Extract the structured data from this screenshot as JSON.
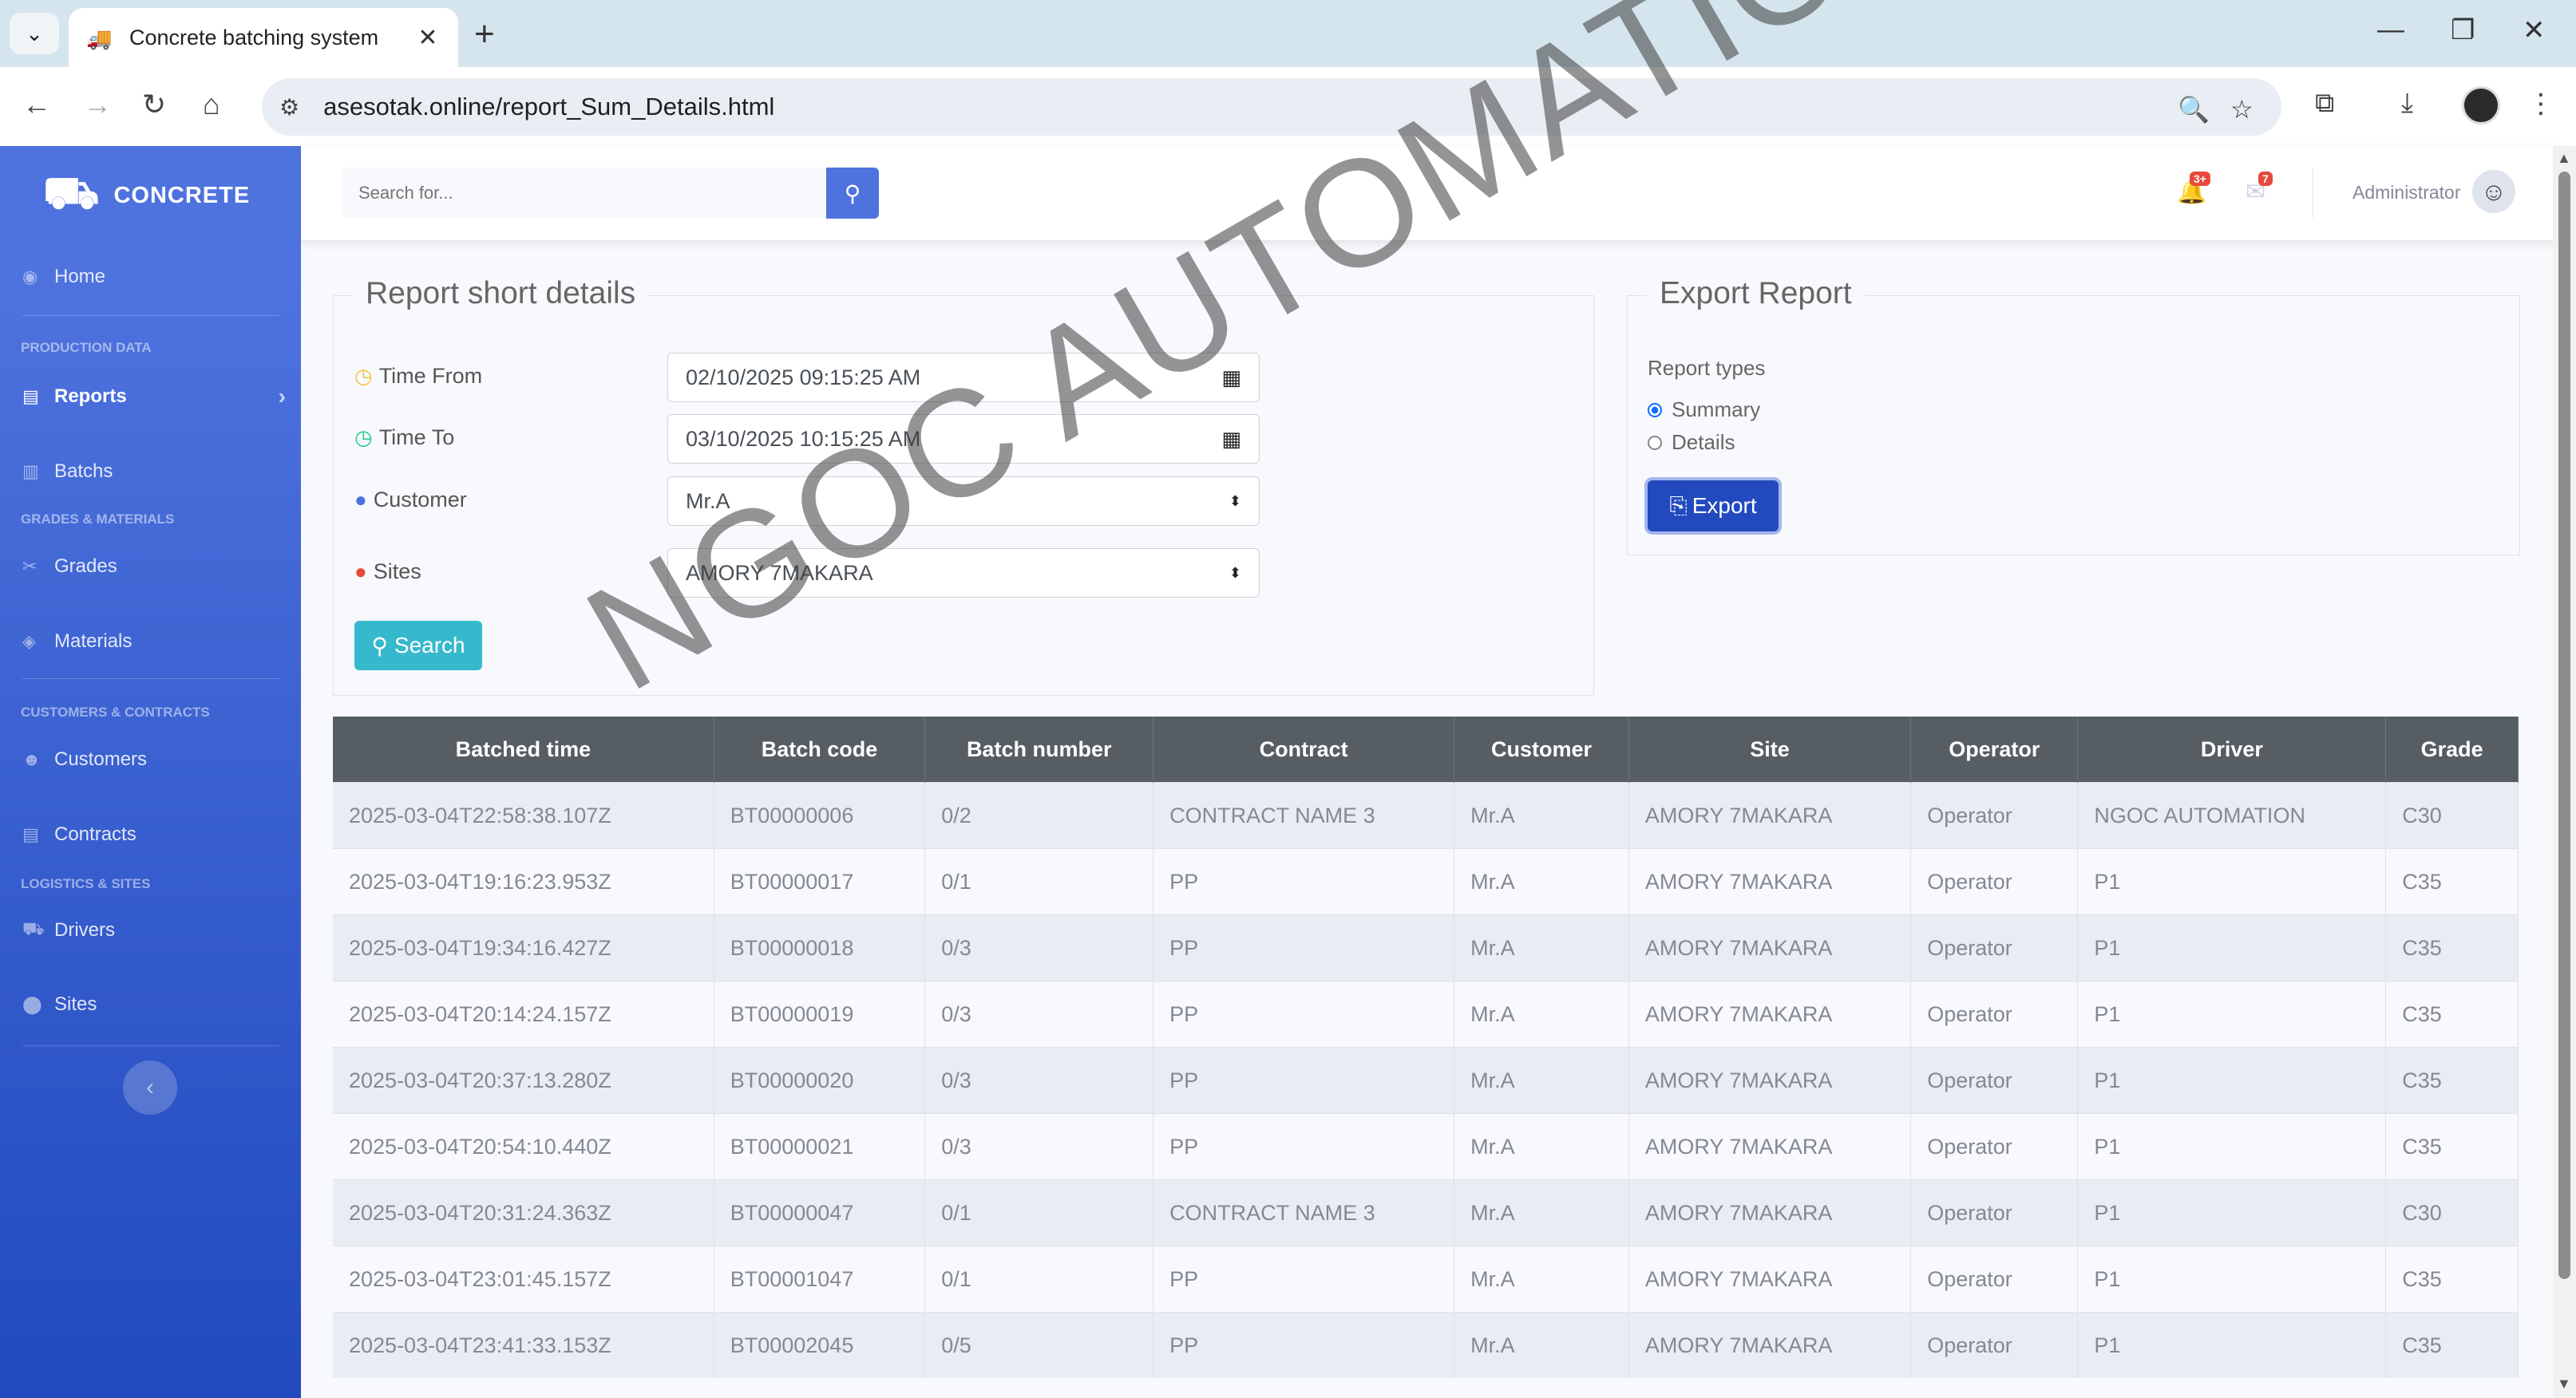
{
  "browser": {
    "tab_title": "Concrete batching system",
    "url": "asesotak.online/report_Sum_Details.html",
    "new_tab": "+",
    "close_tab": "✕"
  },
  "sidebar": {
    "brand": "CONCRETE",
    "items": [
      {
        "label": "Home"
      },
      {
        "label": "Reports"
      },
      {
        "label": "Batchs"
      },
      {
        "label": "Grades"
      },
      {
        "label": "Materials"
      },
      {
        "label": "Customers"
      },
      {
        "label": "Contracts"
      },
      {
        "label": "Drivers"
      },
      {
        "label": "Sites"
      }
    ],
    "headings": [
      "PRODUCTION DATA",
      "GRADES & MATERIALS",
      "CUSTOMERS & CONTRACTS",
      "LOGISTICS & SITES"
    ]
  },
  "topbar": {
    "search_placeholder": "Search for...",
    "alerts_badge": "3+",
    "messages_badge": "7",
    "user_name": "Administrator"
  },
  "filter_panel": {
    "legend": "Report short details",
    "time_from_label": "Time From",
    "time_from_value": "02/10/2025 09:15:25 AM",
    "time_to_label": "Time To",
    "time_to_value": "03/10/2025 10:15:25 AM",
    "customer_label": "Customer",
    "customer_value": "Mr.A",
    "sites_label": "Sites",
    "sites_value": "AMORY 7MAKARA",
    "search_button": "Search"
  },
  "export_panel": {
    "legend": "Export Report",
    "report_types_label": "Report types",
    "option_summary": "Summary",
    "option_details": "Details",
    "selected": "Summary",
    "export_button": "Export"
  },
  "table": {
    "headers": [
      "Batched time",
      "Batch code",
      "Batch number",
      "Contract",
      "Customer",
      "Site",
      "Operator",
      "Driver",
      "Grade"
    ],
    "rows": [
      [
        "2025-03-04T22:58:38.107Z",
        "BT00000006",
        "0/2",
        "CONTRACT NAME 3",
        "Mr.A",
        "AMORY 7MAKARA",
        "Operator",
        "NGOC AUTOMATION",
        "C30"
      ],
      [
        "2025-03-04T19:16:23.953Z",
        "BT00000017",
        "0/1",
        "PP",
        "Mr.A",
        "AMORY 7MAKARA",
        "Operator",
        "P1",
        "C35"
      ],
      [
        "2025-03-04T19:34:16.427Z",
        "BT00000018",
        "0/3",
        "PP",
        "Mr.A",
        "AMORY 7MAKARA",
        "Operator",
        "P1",
        "C35"
      ],
      [
        "2025-03-04T20:14:24.157Z",
        "BT00000019",
        "0/3",
        "PP",
        "Mr.A",
        "AMORY 7MAKARA",
        "Operator",
        "P1",
        "C35"
      ],
      [
        "2025-03-04T20:37:13.280Z",
        "BT00000020",
        "0/3",
        "PP",
        "Mr.A",
        "AMORY 7MAKARA",
        "Operator",
        "P1",
        "C35"
      ],
      [
        "2025-03-04T20:54:10.440Z",
        "BT00000021",
        "0/3",
        "PP",
        "Mr.A",
        "AMORY 7MAKARA",
        "Operator",
        "P1",
        "C35"
      ],
      [
        "2025-03-04T20:31:24.363Z",
        "BT00000047",
        "0/1",
        "CONTRACT NAME 3",
        "Mr.A",
        "AMORY 7MAKARA",
        "Operator",
        "P1",
        "C30"
      ],
      [
        "2025-03-04T23:01:45.157Z",
        "BT00001047",
        "0/1",
        "PP",
        "Mr.A",
        "AMORY 7MAKARA",
        "Operator",
        "P1",
        "C35"
      ],
      [
        "2025-03-04T23:41:33.153Z",
        "BT00002045",
        "0/5",
        "PP",
        "Mr.A",
        "AMORY 7MAKARA",
        "Operator",
        "P1",
        "C35"
      ]
    ]
  },
  "watermark": "NGOC AUTOMATION",
  "colors": {
    "sidebar": "#4e73df",
    "table_header": "#565e64",
    "search_button": "#36b9cc",
    "export_button": "#224abe"
  }
}
